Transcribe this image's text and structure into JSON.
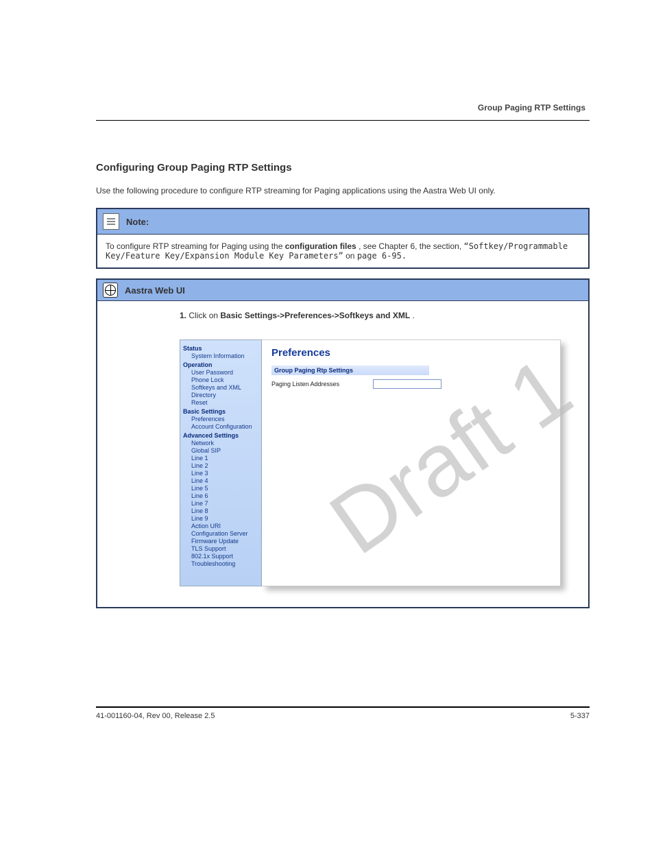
{
  "header": {
    "right": "Group Paging RTP Settings"
  },
  "section_title": "Configuring Group Paging RTP Settings",
  "intro": "Use the following procedure to configure RTP streaming for Paging applications using the Aastra Web UI only.",
  "note": {
    "label": "Note:",
    "body_prefix": "To configure RTP streaming for Paging using the ",
    "body_bold": "configuration files",
    "body_suffix": ", see Chapter 6, the section, ",
    "body_link": "“Softkey/Programmable Key/Feature Key/Expansion Module Key Parameters”",
    "body_end": " on ",
    "body_page": "page 6-95.",
    "body_period": ""
  },
  "webui": {
    "bar_title": "Aastra Web UI",
    "instruction_num": "1.",
    "instruction_prefix": "Click on ",
    "instruction_path": "Basic Settings->Preferences->Softkeys and XML",
    "instruction_suffix": "."
  },
  "watermark": "Draft 1",
  "nav": {
    "groups": [
      {
        "title": "Status",
        "items": [
          "System Information"
        ]
      },
      {
        "title": "Operation",
        "items": [
          "User Password",
          "Phone Lock",
          "Softkeys and XML",
          "Directory",
          "Reset"
        ]
      },
      {
        "title": "Basic Settings",
        "items": [
          "Preferences",
          "Account Configuration"
        ]
      },
      {
        "title": "Advanced Settings",
        "items": [
          "Network",
          "Global SIP",
          "Line 1",
          "Line 2",
          "Line 3",
          "Line 4",
          "Line 5",
          "Line 6",
          "Line 7",
          "Line 8",
          "Line 9",
          "Action URI",
          "Configuration Server",
          "Firmware Update",
          "TLS Support",
          "802.1x Support",
          "Troubleshooting"
        ]
      }
    ]
  },
  "content": {
    "title": "Preferences",
    "section": "Group Paging Rtp Settings",
    "field_label": "Paging Listen Addresses",
    "field_value": ""
  },
  "footer": {
    "left": "41-001160-04, Rev 00, Release 2.5",
    "right": "5-337"
  }
}
